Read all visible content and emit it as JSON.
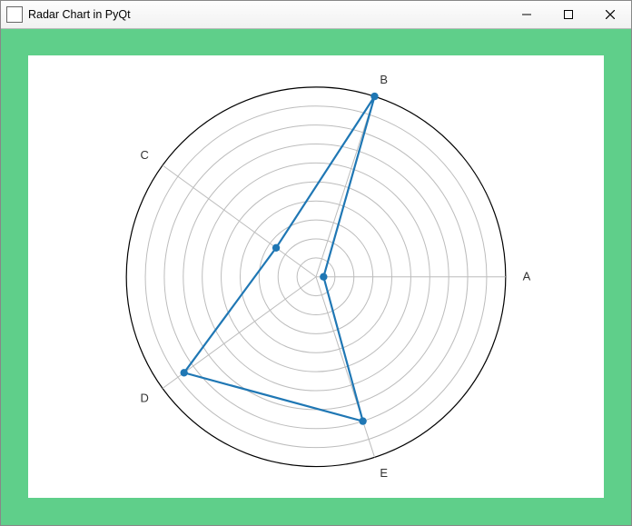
{
  "window": {
    "title": "Radar Chart in PyQt",
    "controls": {
      "minimize": "–",
      "maximize": "□",
      "close": "✕"
    }
  },
  "colors": {
    "accent": "#5fcf8a",
    "series": "#1f77b4"
  },
  "chart_data": {
    "type": "radar",
    "categories": [
      "A",
      "B",
      "C",
      "D",
      "E"
    ],
    "values": [
      0.4,
      10.0,
      2.6,
      8.6,
      8.0
    ],
    "rlim": [
      0,
      10
    ],
    "n_rings": 10,
    "start_angle_deg": 0,
    "direction": "ccw",
    "title": "",
    "legend": false
  }
}
